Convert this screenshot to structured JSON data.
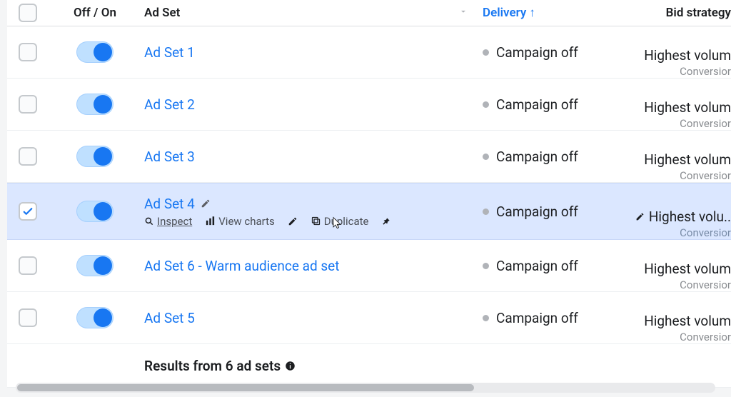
{
  "header": {
    "toggle_label": "Off / On",
    "adset_label": "Ad Set",
    "delivery_label": "Delivery",
    "bid_label": "Bid strategy"
  },
  "rows": [
    {
      "name": "Ad Set 1",
      "delivery": "Campaign off",
      "bid": "Highest volum",
      "bid_sub": "Conversior"
    },
    {
      "name": "Ad Set 2",
      "delivery": "Campaign off",
      "bid": "Highest volum",
      "bid_sub": "Conversior"
    },
    {
      "name": "Ad Set 3",
      "delivery": "Campaign off",
      "bid": "Highest volum",
      "bid_sub": "Conversior"
    },
    {
      "name": "Ad Set 4",
      "delivery": "Campaign off",
      "bid": "Highest volu..",
      "bid_sub": "Conversior"
    },
    {
      "name": "Ad Set 6 - Warm audience ad set",
      "delivery": "Campaign off",
      "bid": "Highest volum",
      "bid_sub": "Conversior"
    },
    {
      "name": "Ad Set 5",
      "delivery": "Campaign off",
      "bid": "Highest volum",
      "bid_sub": "Conversior"
    }
  ],
  "hover_actions": {
    "inspect": "Inspect",
    "view_charts": "View charts",
    "duplicate": "Duplicate"
  },
  "footer": {
    "results_text": "Results from 6 ad sets"
  }
}
